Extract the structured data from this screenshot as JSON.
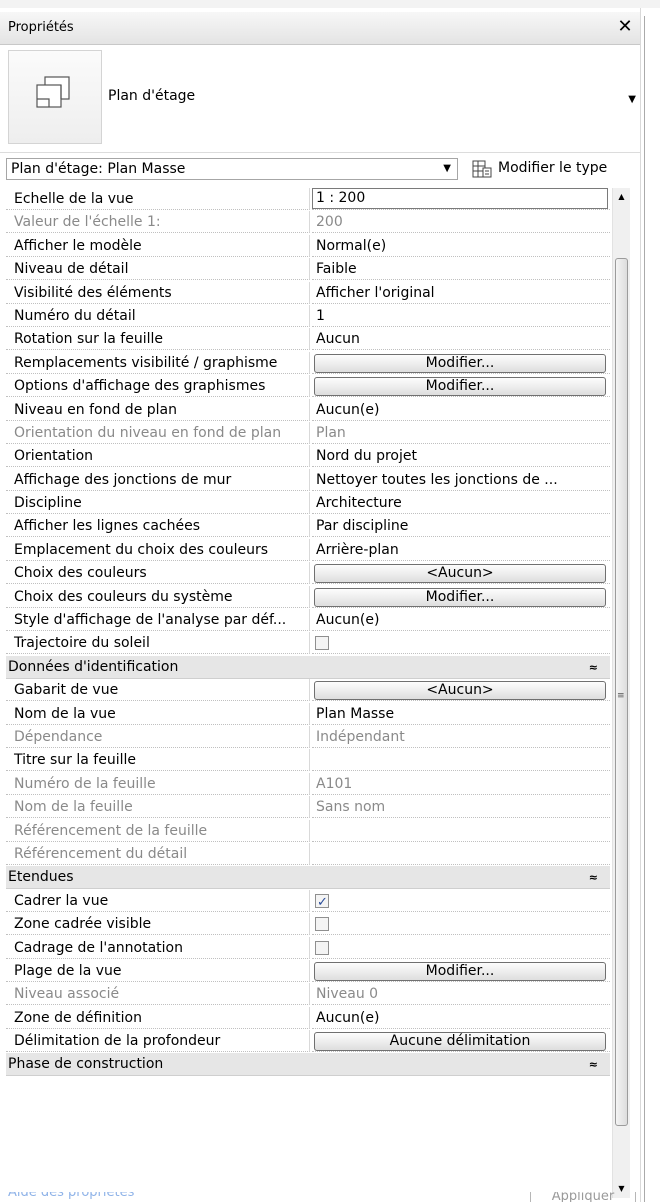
{
  "panel": {
    "title": "Propriétés",
    "close_glyph": "✕"
  },
  "type_selector": {
    "name": "Plan d'étage",
    "dropdown_glyph": "▼",
    "icon": "floor-plan-icon"
  },
  "instance": {
    "selector_value": "Plan d'étage: Plan Masse",
    "dropdown_glyph": "▼",
    "edit_type_label": "Modifier le type"
  },
  "rows": [
    {
      "kind": "text-edit",
      "label": "Echelle de la vue",
      "value": "1 : 200"
    },
    {
      "kind": "text",
      "label": "Valeur de l'échelle    1:",
      "value": "200",
      "dim": true
    },
    {
      "kind": "text",
      "label": "Afficher le modèle",
      "value": "Normal(e)"
    },
    {
      "kind": "text",
      "label": "Niveau de détail",
      "value": "Faible"
    },
    {
      "kind": "text",
      "label": "Visibilité des éléments",
      "value": "Afficher l'original"
    },
    {
      "kind": "text",
      "label": "Numéro du détail",
      "value": "1"
    },
    {
      "kind": "text",
      "label": "Rotation sur la feuille",
      "value": "Aucun"
    },
    {
      "kind": "button",
      "label": "Remplacements visibilité / graphisme",
      "value": "Modifier..."
    },
    {
      "kind": "button",
      "label": "Options d'affichage des graphismes",
      "value": "Modifier..."
    },
    {
      "kind": "text",
      "label": "Niveau en fond de plan",
      "value": "Aucun(e)"
    },
    {
      "kind": "text",
      "label": "Orientation du niveau en fond de plan",
      "value": "Plan",
      "dim": true
    },
    {
      "kind": "text",
      "label": "Orientation",
      "value": "Nord du projet"
    },
    {
      "kind": "text",
      "label": "Affichage des jonctions de mur",
      "value": "Nettoyer toutes les jonctions de ..."
    },
    {
      "kind": "text",
      "label": "Discipline",
      "value": "Architecture"
    },
    {
      "kind": "text",
      "label": "Afficher les lignes cachées",
      "value": "Par discipline"
    },
    {
      "kind": "text",
      "label": "Emplacement du choix des couleurs",
      "value": "Arrière-plan"
    },
    {
      "kind": "button",
      "label": "Choix des couleurs",
      "value": "<Aucun>"
    },
    {
      "kind": "button",
      "label": "Choix des couleurs du système",
      "value": "Modifier..."
    },
    {
      "kind": "text",
      "label": "Style d'affichage de l'analyse par déf...",
      "value": "Aucun(e)"
    },
    {
      "kind": "check",
      "label": "Trajectoire du soleil",
      "checked": false
    },
    {
      "kind": "group",
      "label": "Données d'identification",
      "chevron": "≈"
    },
    {
      "kind": "button",
      "label": "Gabarit de vue",
      "value": "<Aucun>"
    },
    {
      "kind": "text",
      "label": "Nom de la vue",
      "value": "Plan Masse"
    },
    {
      "kind": "text",
      "label": "Dépendance",
      "value": "Indépendant",
      "dim": true
    },
    {
      "kind": "text",
      "label": "Titre sur la feuille",
      "value": ""
    },
    {
      "kind": "text",
      "label": "Numéro de la feuille",
      "value": "A101",
      "dim": true
    },
    {
      "kind": "text",
      "label": "Nom de la feuille",
      "value": "Sans nom",
      "dim": true
    },
    {
      "kind": "text",
      "label": "Référencement de la feuille",
      "value": "",
      "dim": true
    },
    {
      "kind": "text",
      "label": "Référencement du détail",
      "value": "",
      "dim": true
    },
    {
      "kind": "group",
      "label": "Etendues",
      "chevron": "≈"
    },
    {
      "kind": "check",
      "label": "Cadrer la vue",
      "checked": true
    },
    {
      "kind": "check",
      "label": "Zone cadrée visible",
      "checked": false
    },
    {
      "kind": "check",
      "label": "Cadrage de l'annotation",
      "checked": false
    },
    {
      "kind": "button",
      "label": "Plage de la vue",
      "value": "Modifier..."
    },
    {
      "kind": "text",
      "label": "Niveau associé",
      "value": "Niveau 0",
      "dim": true
    },
    {
      "kind": "text",
      "label": "Zone de définition",
      "value": "Aucun(e)"
    },
    {
      "kind": "button",
      "label": "Délimitation de la profondeur",
      "value": "Aucune délimitation"
    },
    {
      "kind": "group",
      "label": "Phase de construction",
      "chevron": "≈"
    }
  ],
  "scrollbar": {
    "up_glyph": "▲",
    "down_glyph": "▼",
    "grip_glyph": "≡"
  },
  "footer": {
    "help_link": "Aide des propriétés",
    "apply_label": "Appliquer"
  }
}
